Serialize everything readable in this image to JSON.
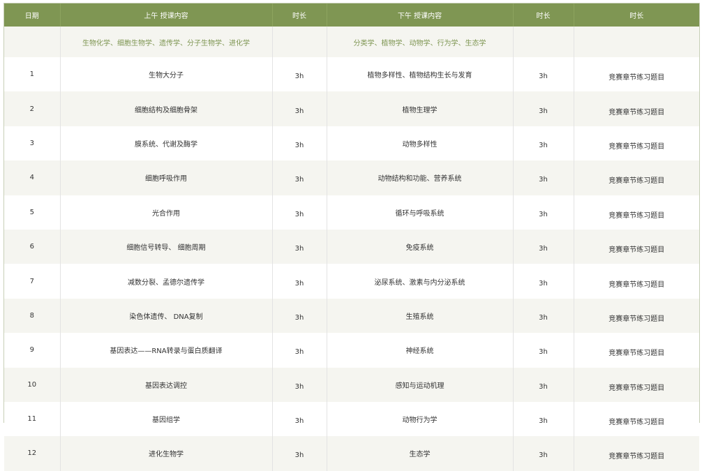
{
  "headers": [
    "日期",
    "上午 授课内容",
    "时长",
    "下午 授课内容",
    "时长",
    "时长"
  ],
  "subheader": {
    "morning": "生物化学、细胞生物学、遗传学、分子生物学、进化学",
    "afternoon": "分类学、植物学、动物学、行为学、生态学"
  },
  "rows": [
    {
      "day": "1",
      "morning": "生物大分子",
      "morning_duration": "3h",
      "afternoon": "植物多样性、植物结构生长与发育",
      "afternoon_duration": "3h",
      "extra": "竞赛章节练习题目"
    },
    {
      "day": "2",
      "morning": "细胞结构及细胞骨架",
      "morning_duration": "3h",
      "afternoon": "植物生理学",
      "afternoon_duration": "3h",
      "extra": "竞赛章节练习题目"
    },
    {
      "day": "3",
      "morning": "膜系统、代谢及酶学",
      "morning_duration": "3h",
      "afternoon": "动物多样性",
      "afternoon_duration": "3h",
      "extra": "竞赛章节练习题目"
    },
    {
      "day": "4",
      "morning": "细胞呼吸作用",
      "morning_duration": "3h",
      "afternoon": "动物结构和功能、营养系统",
      "afternoon_duration": "3h",
      "extra": "竞赛章节练习题目"
    },
    {
      "day": "5",
      "morning": "光合作用",
      "morning_duration": "3h",
      "afternoon": "循环与呼吸系统",
      "afternoon_duration": "3h",
      "extra": "竞赛章节练习题目"
    },
    {
      "day": "6",
      "morning": "细胞信号转导、 细胞周期",
      "morning_duration": "3h",
      "afternoon": "免疫系统",
      "afternoon_duration": "3h",
      "extra": "竞赛章节练习题目"
    },
    {
      "day": "7",
      "morning": "减数分裂、孟德尔遗传学",
      "morning_duration": "3h",
      "afternoon": "泌尿系统、激素与内分泌系统",
      "afternoon_duration": "3h",
      "extra": "竞赛章节练习题目"
    },
    {
      "day": "8",
      "morning": "染色体遗传、 DNA复制",
      "morning_duration": "3h",
      "afternoon": "生殖系统",
      "afternoon_duration": "3h",
      "extra": "竞赛章节练习题目"
    },
    {
      "day": "9",
      "morning": "基因表达——RNA转录与蛋白质翻译",
      "morning_duration": "3h",
      "afternoon": "神经系统",
      "afternoon_duration": "3h",
      "extra": "竞赛章节练习题目"
    },
    {
      "day": "10",
      "morning": "基因表达调控",
      "morning_duration": "3h",
      "afternoon": "感知与运动机理",
      "afternoon_duration": "3h",
      "extra": "竞赛章节练习题目"
    },
    {
      "day": "11",
      "morning": "基因组学",
      "morning_duration": "3h",
      "afternoon": "动物行为学",
      "afternoon_duration": "3h",
      "extra": "竞赛章节练习题目"
    },
    {
      "day": "12",
      "morning": "进化生物学",
      "morning_duration": "3h",
      "afternoon": "生态学",
      "afternoon_duration": "3h",
      "extra": "竞赛章节练习题目"
    }
  ],
  "colors": {
    "header_bg": "#7f9653",
    "subheader_text": "#7f9653",
    "stripe": "#f5f5f0"
  }
}
